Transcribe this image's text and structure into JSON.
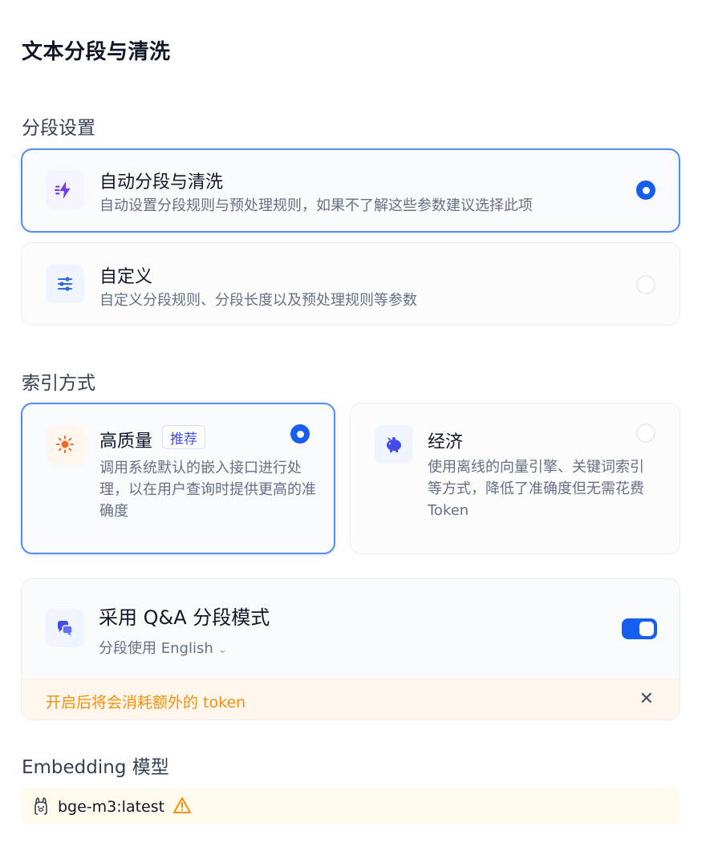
{
  "page_title": "文本分段与清洗",
  "segment_settings": {
    "title": "分段设置",
    "options": [
      {
        "title": "自动分段与清洗",
        "description": "自动设置分段规则与预处理规则，如果不了解这些参数建议选择此项",
        "selected": true,
        "icon": "lightning-icon"
      },
      {
        "title": "自定义",
        "description": "自定义分段规则、分段长度以及预处理规则等参数",
        "selected": false,
        "icon": "sliders-icon"
      }
    ]
  },
  "index_mode": {
    "title": "索引方式",
    "options": [
      {
        "title": "高质量",
        "badge": "推荐",
        "description": "调用系统默认的嵌入接口进行处理，以在用户查询时提供更高的准确度",
        "selected": true,
        "icon": "sun-icon"
      },
      {
        "title": "经济",
        "description": "使用离线的向量引擎、关键词索引等方式，降低了准确度但无需花费 Token",
        "selected": false,
        "icon": "piggy-bank-icon"
      }
    ]
  },
  "qa_mode": {
    "title": "采用 Q&A 分段模式",
    "language_prefix": "分段使用",
    "language": "English",
    "enabled": true,
    "warning": "开启后将会消耗额外的 token"
  },
  "embedding": {
    "title": "Embedding 模型",
    "model": "bge-m3:latest"
  },
  "colors": {
    "primary": "#155eef",
    "active_border": "#528bff",
    "warning": "#f79009"
  }
}
